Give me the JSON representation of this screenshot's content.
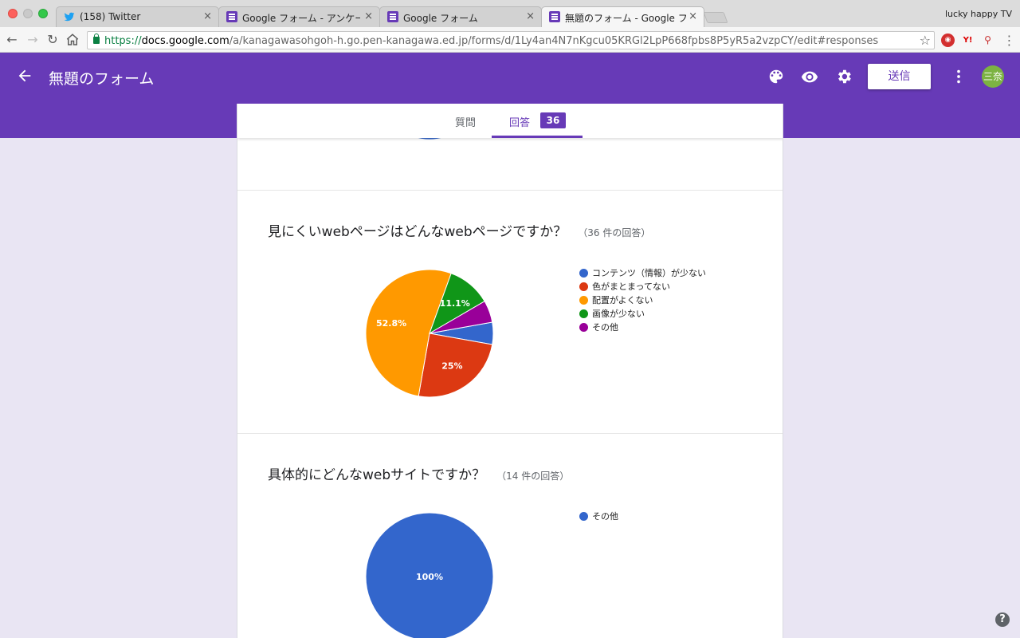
{
  "browser": {
    "tabs": [
      {
        "title": "(158) Twitter",
        "icon": "twitter-icon"
      },
      {
        "title": "Google フォーム - アンケートを作",
        "icon": "forms-icon"
      },
      {
        "title": "Google フォーム",
        "icon": "forms-icon"
      },
      {
        "title": "無題のフォーム - Google フォーム",
        "icon": "forms-icon",
        "active": true
      }
    ],
    "profile_name": "lucky happy TV",
    "url_scheme": "https://",
    "url_host": "docs.google.com",
    "url_path": "/a/kanagawasohgoh-h.go.pen-kanagawa.ed.jp/forms/d/1Ly4an4N7nKgcu05KRGl2LpP668fpbs8P5yR5a2vzpCY/edit#responses"
  },
  "header": {
    "title": "無題のフォーム",
    "send_label": "送信",
    "avatar_text": "三奈",
    "accent": "#673ab7"
  },
  "form_tabs": {
    "questions_label": "質問",
    "responses_label": "回答",
    "responses_count": "36"
  },
  "chart_data": [
    {
      "type": "pie",
      "title": "見にくいwebページはどんなwebページですか？",
      "responses": "（36 件の回答）",
      "categories": [
        "コンテンツ（情報）が少ない",
        "色がまとまってない",
        "配置がよくない",
        "画像が少ない",
        "その他"
      ],
      "values": [
        5.6,
        25,
        52.8,
        11.1,
        5.6
      ],
      "data_labels": [
        "",
        "25%",
        "52.8%",
        "11.1%",
        ""
      ],
      "colors": [
        "#3366cc",
        "#dc3912",
        "#ff9900",
        "#109618",
        "#990099"
      ],
      "legend": "right"
    },
    {
      "type": "pie",
      "title": "具体的にどんなwebサイトですか？",
      "responses": "（14 件の回答）",
      "categories": [
        "その他"
      ],
      "values": [
        100
      ],
      "data_labels": [
        "100%"
      ],
      "colors": [
        "#3366cc"
      ],
      "legend": "right"
    }
  ],
  "help_label": "?"
}
